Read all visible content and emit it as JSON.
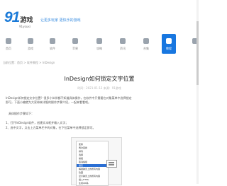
{
  "header": {
    "logo_number": "91",
    "logo_cn": "游戏",
    "logo_en": "91youxi",
    "slogan": "让更多玩家 更快乐的游戏"
  },
  "nav": {
    "items": [
      {
        "label": "首页"
      },
      {
        "label": "游戏"
      },
      {
        "label": "软件"
      },
      {
        "label": "苹果"
      },
      {
        "label": "攻略"
      },
      {
        "label": "资讯"
      },
      {
        "label": "合集"
      },
      {
        "label": "教程"
      },
      {
        "label": "专题"
      }
    ],
    "active_index": 7
  },
  "breadcrumb": "当前位置：首页 > 软件教程 > InDesign",
  "article": {
    "title": "InDesign如何锁定文字位置",
    "meta": "时间：2021-01-12  来源：91游戏",
    "paragraphs": [
      "InDesign如何锁定文字位置？很多小伙伴都不知道具体操作，在软件中只需要在对象菜单中选择锁定",
      "即可，下面小编就为大家带来详细的操作步骤介绍，一起来看看吧。",
      "具体操作步骤如下：",
      "1、打开InDesign软件，创建文本框并输入文字；",
      "2、选中文字，点击上方菜单栏中的对象，在下拉菜单中选择锁定即可。"
    ]
  },
  "screenshot_menu": {
    "items": [
      "变换",
      "再次变换",
      "排列",
      "选择",
      "编组",
      "取消编组",
      "锁定",
      "解锁跨页上的所有内容",
      "隐藏",
      "显示跨页上的所有内容",
      "插入HTML",
      "生成QR码"
    ],
    "highlighted_index": 6
  }
}
